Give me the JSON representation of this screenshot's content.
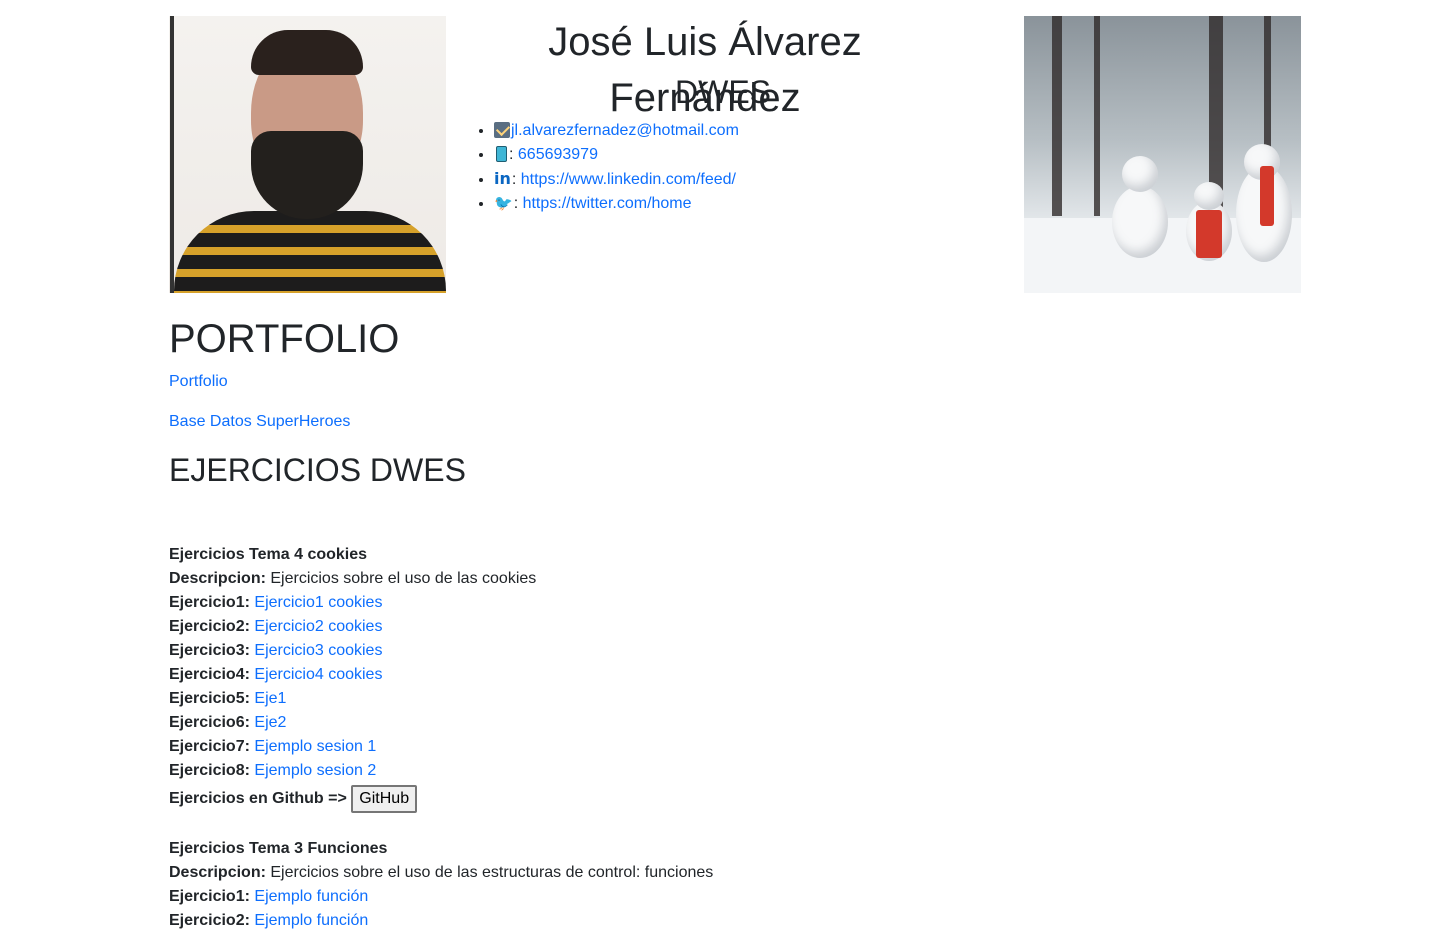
{
  "header": {
    "name": "José Luis Álvarez Fernández",
    "subject": "DWES",
    "contacts": [
      {
        "icon": "mail-icon",
        "separator": "",
        "text": "jl.alvarezfernadez@hotmail.com"
      },
      {
        "icon": "phone-icon",
        "separator": ": ",
        "text": "665693979"
      },
      {
        "icon": "linkedin-icon",
        "separator": ": ",
        "text": "https://www.linkedin.com/feed/"
      },
      {
        "icon": "twitter-icon",
        "separator": ": ",
        "text": "https://twitter.com/home"
      }
    ]
  },
  "portfolio": {
    "heading": "PORTFOLIO",
    "link_portfolio": "Portfolio",
    "link_superheroes": "Base Datos SuperHeroes"
  },
  "ejercicios": {
    "heading": "EJERCICIOS DWES",
    "tema4": {
      "title": "Ejercicios Tema 4 cookies",
      "desc_label": "Descripcion:",
      "desc_text": " Ejercicios sobre el uso de las cookies",
      "items": [
        {
          "label": "Ejercicio1:",
          "link": "Ejercicio1 cookies"
        },
        {
          "label": "Ejercicio2:",
          "link": "Ejercicio2 cookies"
        },
        {
          "label": "Ejercicio3:",
          "link": "Ejercicio3 cookies"
        },
        {
          "label": "Ejercicio4:",
          "link": "Ejercicio4 cookies"
        },
        {
          "label": "Ejercicio5:",
          "link": "Eje1"
        },
        {
          "label": "Ejercicio6:",
          "link": "Eje2"
        },
        {
          "label": "Ejercicio7:",
          "link": "Ejemplo sesion 1"
        },
        {
          "label": "Ejercicio8:",
          "link": "Ejemplo sesion 2"
        }
      ],
      "github_label": "Ejercicios en Github =>",
      "github_button": "GitHub"
    },
    "tema3": {
      "title": "Ejercicios Tema 3 Funciones",
      "desc_label": "Descripcion:",
      "desc_text": " Ejercicios sobre el uso de las estructuras de control: funciones",
      "items": [
        {
          "label": "Ejercicio1:",
          "link": "Ejemplo función"
        },
        {
          "label": "Ejercicio2:",
          "link": "Ejemplo función"
        }
      ]
    }
  },
  "colors": {
    "link": "#0d6efd",
    "text": "#212529"
  }
}
